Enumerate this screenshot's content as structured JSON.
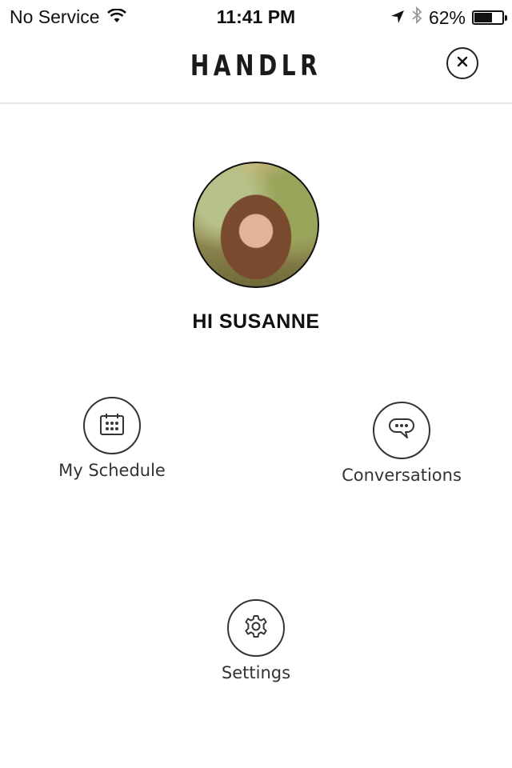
{
  "status_bar": {
    "carrier": "No Service",
    "time": "11:41 PM",
    "battery_percent_label": "62%",
    "battery_level": 0.62,
    "icons": [
      "wifi-icon",
      "location-arrow-icon",
      "bluetooth-icon",
      "battery-icon"
    ]
  },
  "header": {
    "logo": "HANDLR",
    "close_icon": "close-icon"
  },
  "profile": {
    "greeting": "HI SUSANNE",
    "avatar": "avatar"
  },
  "menu": {
    "items": [
      {
        "label": "My Schedule",
        "icon": "calendar-icon"
      },
      {
        "label": "Conversations",
        "icon": "chat-bubble-icon"
      },
      {
        "label": "Settings",
        "icon": "gear-icon"
      }
    ]
  }
}
